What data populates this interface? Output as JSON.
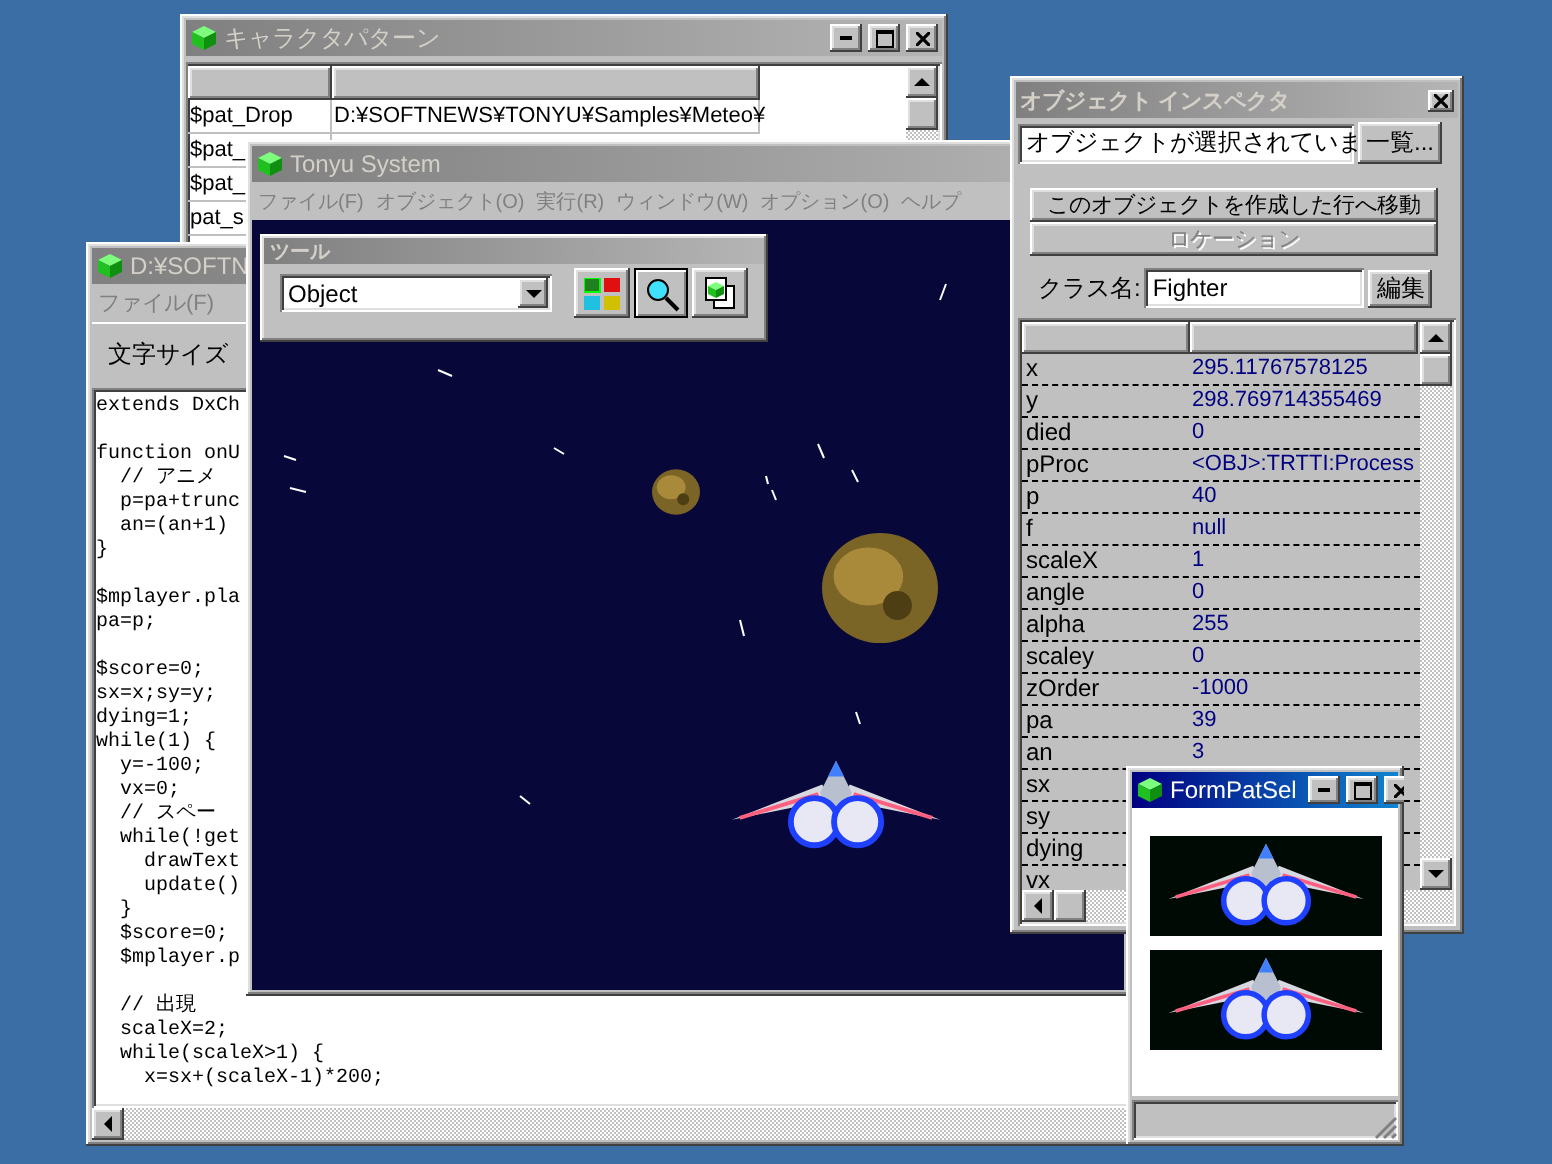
{
  "pattern_window": {
    "title": "キャラクタパターン",
    "active": false,
    "rows": [
      {
        "name": "$pat_Drop",
        "path": "D:¥SOFTNEWS¥TONYU¥Samples¥Meteo¥"
      },
      {
        "name": "$pat_"
      },
      {
        "name": "$pat_"
      },
      {
        "name": "pat_s"
      }
    ]
  },
  "editor_window": {
    "title": "D:¥SOFTN",
    "active": false,
    "menu": [
      "ファイル(F)"
    ],
    "toolbar_label": "文字サイズ",
    "code_blocks": [
      [
        "extends DxCh"
      ],
      [
        "function onU",
        "  // アニメ",
        "  p=pa+trunc",
        "  an=(an+1)",
        "}"
      ],
      [
        "$mplayer.pla",
        "pa=p;"
      ],
      [
        "$score=0;",
        "sx=x;sy=y;",
        "dying=1;",
        "while(1) {",
        "  y=-100;",
        "  vx=0;",
        "  // スペー",
        "  while(!get",
        "    drawText",
        "    update()",
        "  }",
        "  $score=0;",
        "  $mplayer.p"
      ],
      [
        "  // 出現",
        "  scaleX=2;",
        "  while(scaleX>1) {",
        "    x=sx+(scaleX-1)*200;"
      ]
    ]
  },
  "main_window": {
    "title": "Tonyu System",
    "active": false,
    "menu": [
      "ファイル(F)",
      "オブジェクト(O)",
      "実行(R)",
      "ウィンドウ(W)",
      "オプション(O)",
      "ヘルプ"
    ],
    "tool_palette": {
      "title": "ツール",
      "object_select": "Object",
      "tools": [
        {
          "kind": "patterns",
          "selected": false
        },
        {
          "kind": "inspect",
          "selected": true
        },
        {
          "kind": "copy",
          "selected": false
        }
      ]
    }
  },
  "inspector": {
    "title": "オブジェクト インスペクタ",
    "active": false,
    "object_select": "オブジェクトが選択されていま",
    "list_button": "一覧...",
    "jump_button": {
      "label": "このオブジェクトを作成した行へ移動",
      "disabled": false
    },
    "location_button": {
      "label": "ロケーション",
      "disabled": true
    },
    "class_label": "クラス名:",
    "class_value": "Fighter",
    "edit_button": "編集",
    "properties": [
      {
        "name": "x",
        "value": "295.11767578125"
      },
      {
        "name": "y",
        "value": "298.769714355469"
      },
      {
        "name": "died",
        "value": "0"
      },
      {
        "name": "pProc",
        "value": "<OBJ>:TRTTI:Process"
      },
      {
        "name": "p",
        "value": "40"
      },
      {
        "name": "f",
        "value": "null"
      },
      {
        "name": "scaleX",
        "value": "1"
      },
      {
        "name": "angle",
        "value": "0"
      },
      {
        "name": "alpha",
        "value": "255"
      },
      {
        "name": "scaley",
        "value": "0"
      },
      {
        "name": "zOrder",
        "value": "-1000"
      },
      {
        "name": "pa",
        "value": "39"
      },
      {
        "name": "an",
        "value": "3"
      },
      {
        "name": "sx"
      },
      {
        "name": "sy"
      },
      {
        "name": "dying"
      },
      {
        "name": "vx"
      }
    ]
  },
  "pattern_select": {
    "title": "FormPatSel",
    "active": true,
    "patterns": [
      {
        "kind": "ship"
      },
      {
        "kind": "ship"
      }
    ]
  }
}
